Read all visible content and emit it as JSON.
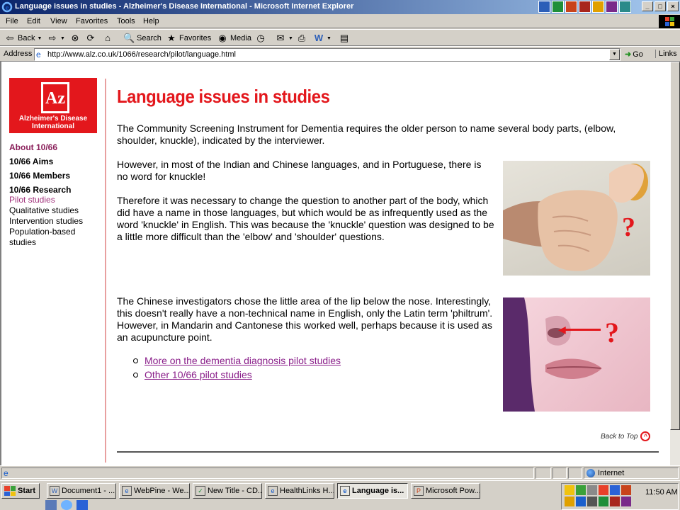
{
  "window": {
    "title": "Language issues in studies - Alzheimer's Disease International - Microsoft Internet Explorer"
  },
  "menu": [
    "File",
    "Edit",
    "View",
    "Favorites",
    "Tools",
    "Help"
  ],
  "toolbar": {
    "back": "Back",
    "search": "Search",
    "favorites": "Favorites",
    "media": "Media"
  },
  "address": {
    "label": "Address",
    "url": "http://www.alz.co.uk/1066/research/pilot/language.html",
    "go": "Go",
    "links": "Links"
  },
  "site": {
    "logo_letters": "Az",
    "logo_line1": "Alzheimer's Disease",
    "logo_line2": "International",
    "nav": {
      "about": "About 10/66",
      "aims": "10/66 Aims",
      "members": "10/66 Members",
      "research": "10/66 Research",
      "sub": [
        "Pilot studies",
        "Qualitative studies",
        "Intervention studies",
        "Population-based",
        "studies"
      ]
    }
  },
  "article": {
    "title": "Language issues in studies",
    "p1": "The Community Screening Instrument for Dementia requires the older person to name several body parts, (elbow, shoulder, knuckle), indicated by the interviewer.",
    "p2": "However, in most of the Indian and Chinese languages, and in Portuguese, there is no word for knuckle!",
    "p3": "Therefore it was necessary to change the question to another part of the body, which did have a name in those languages, but which would be as infrequently used as the word 'knuckle' in English. This was because the 'knuckle' question was designed to be a little more difficult than the 'elbow' and 'shoulder' questions.",
    "p4": "The Chinese investigators chose the little area of the lip below the nose. Interestingly, this doesn't really have a non-technical name in English, only the Latin term 'philtrum'. However, in Mandarin and Cantonese this worked well, perhaps because it is used as an acupuncture point.",
    "links": [
      "More on the dementia diagnosis pilot studies",
      "Other 10/66 pilot studies"
    ],
    "back_to_top": "Back to Top",
    "question_mark": "?"
  },
  "status": {
    "zone": "Internet"
  },
  "taskbar": {
    "start": "Start",
    "tasks": [
      "Document1 - ...",
      "WebPine - We...",
      "New Title - CD...",
      "HealthLinks H...",
      "Language is...",
      "Microsoft Pow..."
    ],
    "clock": "11:50 AM"
  },
  "colors": {
    "brand_red": "#e3171c",
    "link_visited": "#8a1f8a",
    "titlebar_start": "#0a246a"
  }
}
